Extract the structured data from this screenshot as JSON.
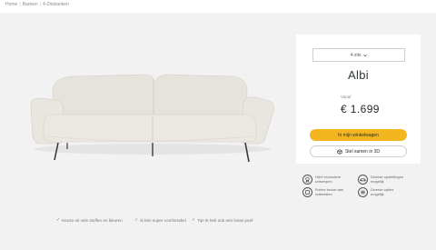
{
  "breadcrumb": {
    "items": [
      "Home",
      "Banken",
      "4-Zitsbanken"
    ]
  },
  "product": {
    "variant_label": "4-zits",
    "title": "Albi",
    "price_label": "Vanaf",
    "price": "€ 1.699"
  },
  "actions": {
    "add_to_cart": "In mijn winkelwagen",
    "design_3d": "Stel samen in 3D"
  },
  "features": [
    {
      "icon": "ribbon-icon",
      "text": "H&H exclusieve ontwerpen"
    },
    {
      "icon": "sofa-icon",
      "text": "Diverse opstellingen mogelijk"
    },
    {
      "icon": "fabric-icon",
      "text": "Ruime keuze aan materialen"
    },
    {
      "icon": "options-icon",
      "text": "Diverse opties mogelijk"
    }
  ],
  "usps": [
    "Keuze uit vele stoffen en kleuren",
    "Ik ben super comfortabel",
    "Tip! Ik heb ook een losse poef"
  ],
  "colors": {
    "accent": "#f3b61f",
    "check": "#2fa84f",
    "sofa": "#e8e4de"
  }
}
